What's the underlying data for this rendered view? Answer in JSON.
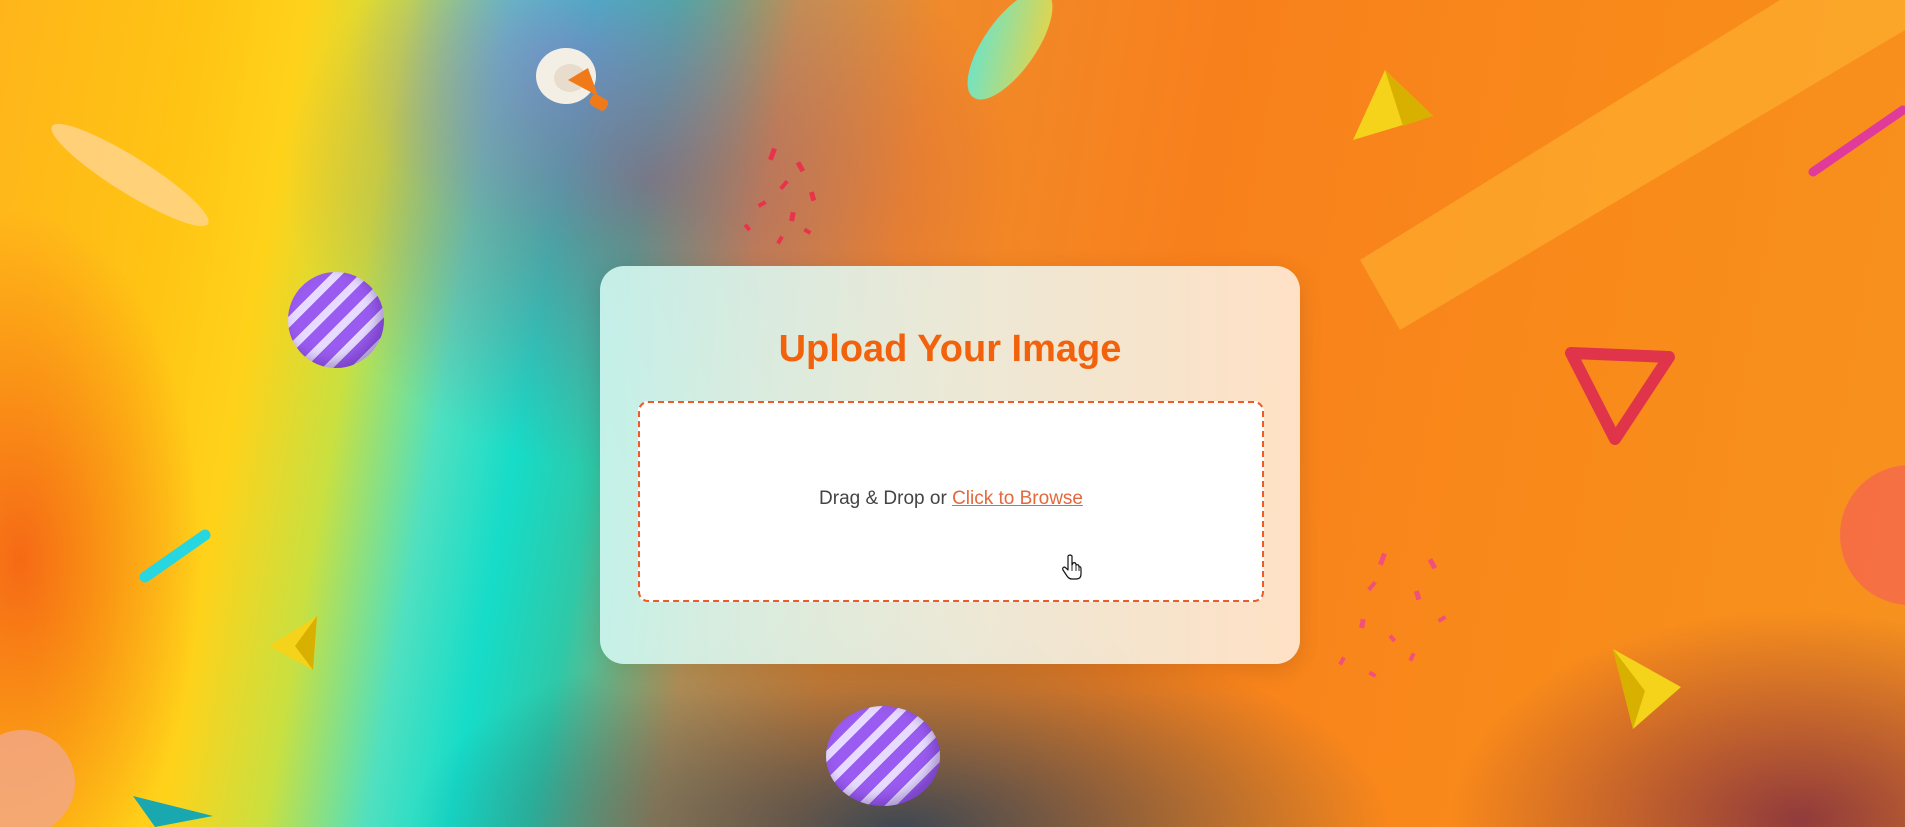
{
  "page": {
    "title": "Upload Your Image"
  },
  "dropzone": {
    "prefix_text": "Drag & Drop or ",
    "browse_link_label": "Click to Browse"
  },
  "colors": {
    "accent": "#f2620d",
    "dropzone_border": "#ec5b28",
    "link": "#e4683e",
    "text": "#444444"
  },
  "decorations": [
    "megaphone-icon",
    "striped-ball-icon",
    "triangle-icon",
    "confetti-icon",
    "capsule-icon"
  ]
}
